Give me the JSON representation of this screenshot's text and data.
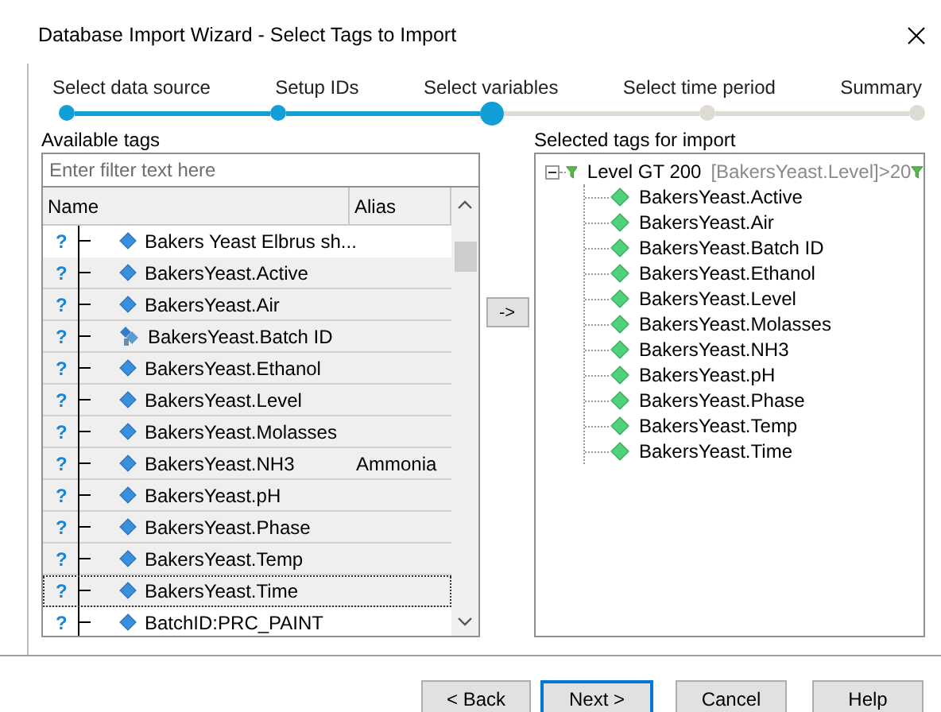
{
  "window": {
    "title": "Database Import Wizard - Select Tags to Import"
  },
  "steps": [
    {
      "label": "Select data source",
      "completed": true,
      "current": false
    },
    {
      "label": "Setup IDs",
      "completed": true,
      "current": false
    },
    {
      "label": "Select variables",
      "completed": false,
      "current": true
    },
    {
      "label": "Select time period",
      "completed": false,
      "current": false
    },
    {
      "label": "Summary",
      "completed": false,
      "current": false
    }
  ],
  "available_tags": {
    "label": "Available tags",
    "filter": {
      "placeholder": "Enter filter text here"
    },
    "columns": [
      "Name",
      "Alias"
    ],
    "rows": [
      {
        "status": "?",
        "kind": "diamond",
        "name": "Bakers Yeast Elbrus sh...",
        "selected": false,
        "focused": false
      },
      {
        "status": "?",
        "kind": "diamond",
        "name": "BakersYeast.Active",
        "selected": true,
        "focused": false
      },
      {
        "status": "?",
        "kind": "diamond",
        "name": "BakersYeast.Air",
        "selected": true,
        "focused": false
      },
      {
        "status": "?",
        "kind": "cluster",
        "name": "BakersYeast.Batch ID",
        "selected": true,
        "focused": false
      },
      {
        "status": "?",
        "kind": "diamond",
        "name": "BakersYeast.Ethanol",
        "selected": true,
        "focused": false
      },
      {
        "status": "?",
        "kind": "diamond",
        "name": "BakersYeast.Level",
        "selected": true,
        "focused": false
      },
      {
        "status": "?",
        "kind": "diamond",
        "name": "BakersYeast.Molasses",
        "selected": true,
        "focused": false
      },
      {
        "status": "?",
        "kind": "diamond",
        "name": "BakersYeast.NH3",
        "alias": "Ammonia",
        "selected": true,
        "focused": false
      },
      {
        "status": "?",
        "kind": "diamond",
        "name": "BakersYeast.pH",
        "selected": true,
        "focused": false
      },
      {
        "status": "?",
        "kind": "diamond",
        "name": "BakersYeast.Phase",
        "selected": true,
        "focused": false
      },
      {
        "status": "?",
        "kind": "diamond",
        "name": "BakersYeast.Temp",
        "selected": true,
        "focused": false
      },
      {
        "status": "?",
        "kind": "diamond",
        "name": "BakersYeast.Time",
        "selected": true,
        "focused": true
      },
      {
        "status": "?",
        "kind": "diamond",
        "name": "BatchID:PRC_PAINT",
        "selected": false,
        "focused": false
      }
    ]
  },
  "move_button": "->",
  "selected_tags": {
    "label": "Selected tags for import",
    "tree": [
      {
        "name": "Level GT 200",
        "condition": "[BakersYeast.Level]>20",
        "expanded": true,
        "children": [
          {
            "name": "BakersYeast.Active"
          },
          {
            "name": "BakersYeast.Air"
          },
          {
            "name": "BakersYeast.Batch ID"
          },
          {
            "name": "BakersYeast.Ethanol"
          },
          {
            "name": "BakersYeast.Level"
          },
          {
            "name": "BakersYeast.Molasses"
          },
          {
            "name": "BakersYeast.NH3"
          },
          {
            "name": "BakersYeast.pH"
          },
          {
            "name": "BakersYeast.Phase"
          },
          {
            "name": "BakersYeast.Temp"
          },
          {
            "name": "BakersYeast.Time"
          }
        ]
      }
    ]
  },
  "buttons": [
    {
      "label": "< Back",
      "default": false
    },
    {
      "label": "Next >",
      "default": true
    },
    {
      "label": "Cancel",
      "default": false
    },
    {
      "label": "Help",
      "default": false
    }
  ]
}
